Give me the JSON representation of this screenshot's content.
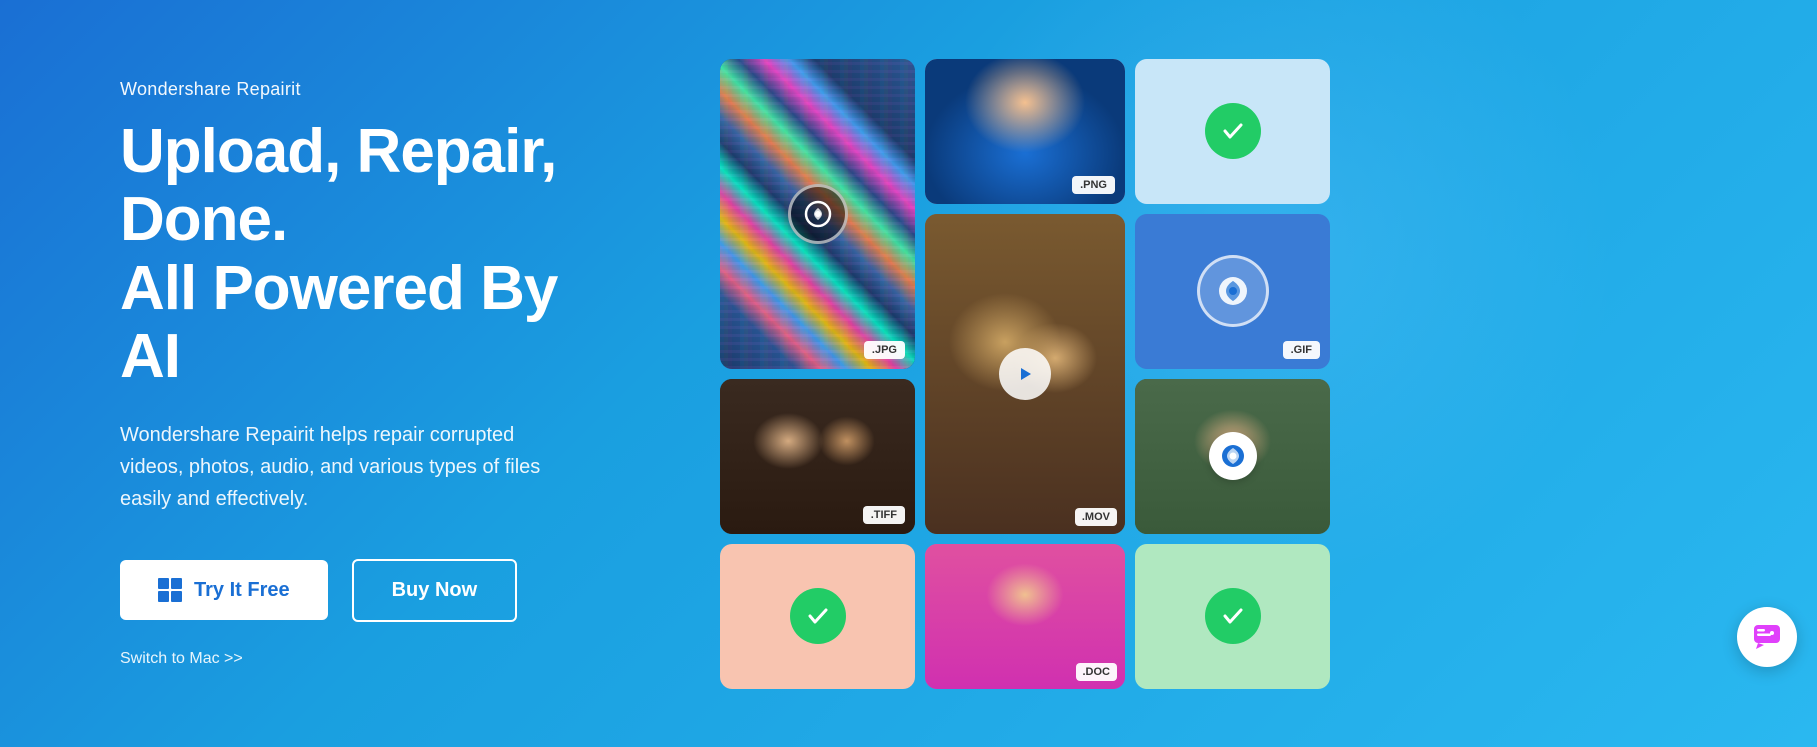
{
  "hero": {
    "brand": "Wondershare Repairit",
    "headline_line1": "Upload, Repair, Done.",
    "headline_line2": "All Powered By AI",
    "description": "Wondershare Repairit helps repair corrupted\nvideos, photos, audio, and various types of files\neasily and effectively.",
    "btn_try": "Try It Free",
    "btn_buy": "Buy Now",
    "switch_link": "Switch to Mac >>",
    "gradient_start": "#1a6fd4",
    "gradient_end": "#2ab8f0"
  },
  "media_cards": {
    "jpg_badge": ".JPG",
    "png_badge": ".PNG",
    "tiff_badge": ".TIFF",
    "mov_badge": ".MOV",
    "doc_badge": ".DOC",
    "gif_badge": ".GIF"
  },
  "chat_widget": {
    "label": "Chat support"
  }
}
